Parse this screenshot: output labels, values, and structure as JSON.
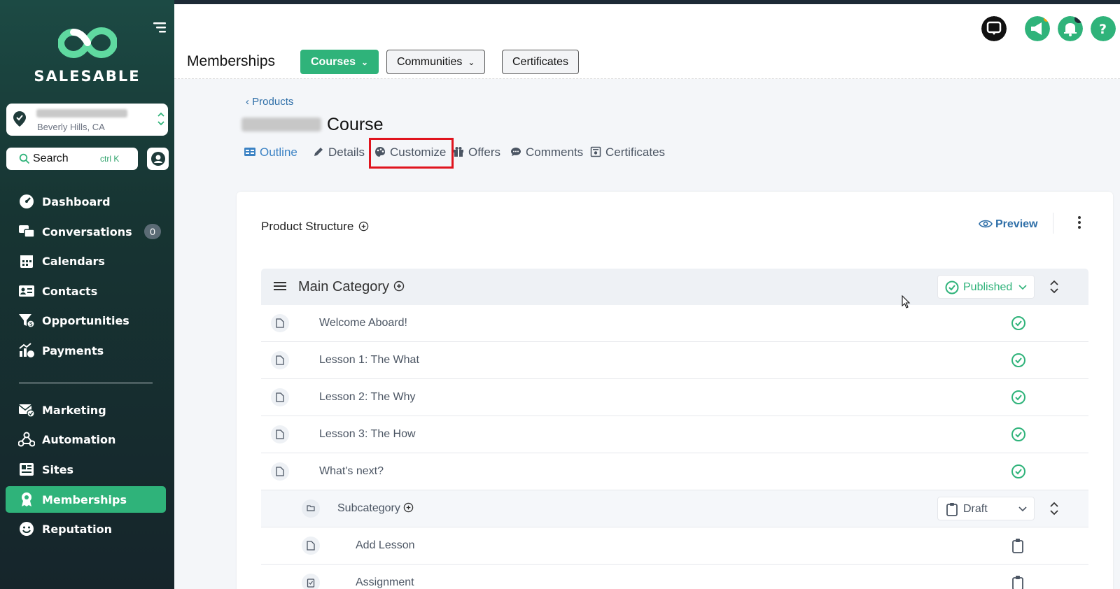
{
  "brand": {
    "name": "SALESABLE"
  },
  "location": {
    "city": "Beverly Hills, CA"
  },
  "search": {
    "label": "Search",
    "shortcut": "ctrl K"
  },
  "nav": {
    "items": [
      {
        "label": "Dashboard",
        "icon": "dashboard-icon"
      },
      {
        "label": "Conversations",
        "icon": "chat-icon",
        "badge": "0"
      },
      {
        "label": "Calendars",
        "icon": "calendar-icon"
      },
      {
        "label": "Contacts",
        "icon": "contacts-icon"
      },
      {
        "label": "Opportunities",
        "icon": "filter-dollar-icon"
      },
      {
        "label": "Payments",
        "icon": "payments-icon"
      },
      {
        "label": "Marketing",
        "icon": "mail-check-icon"
      },
      {
        "label": "Automation",
        "icon": "automation-icon"
      },
      {
        "label": "Sites",
        "icon": "sites-icon"
      },
      {
        "label": "Memberships",
        "icon": "award-icon",
        "active": true
      },
      {
        "label": "Reputation",
        "icon": "smile-icon"
      }
    ]
  },
  "header": {
    "title": "Memberships",
    "pills": [
      {
        "label": "Courses",
        "caret": true,
        "style": "green"
      },
      {
        "label": "Communities",
        "caret": true,
        "style": "grey"
      },
      {
        "label": "Certificates",
        "caret": false,
        "style": "grey"
      }
    ]
  },
  "breadcrumb": "Products",
  "course": {
    "title_suffix": "Course"
  },
  "tabs": [
    {
      "label": "Outline",
      "icon": "outline-icon",
      "active": true
    },
    {
      "label": "Details",
      "icon": "pencil-icon"
    },
    {
      "label": "Customize",
      "icon": "palette-icon",
      "highlighted": true
    },
    {
      "label": "Offers",
      "icon": "gift-icon"
    },
    {
      "label": "Comments",
      "icon": "comment-icon"
    },
    {
      "label": "Certificates",
      "icon": "certificate-icon"
    }
  ],
  "structure": {
    "title": "Product Structure",
    "preview_label": "Preview",
    "category": {
      "name": "Main Category",
      "status": "Published"
    },
    "lessons": [
      {
        "title": "Welcome Aboard!",
        "state": "published"
      },
      {
        "title": "Lesson 1: The What",
        "state": "published"
      },
      {
        "title": "Lesson 2: The Why",
        "state": "published"
      },
      {
        "title": "Lesson 3: The How",
        "state": "published"
      },
      {
        "title": "What's next?",
        "state": "published"
      }
    ],
    "subcategory": {
      "name": "Subcategory",
      "status": "Draft",
      "items": [
        {
          "title": "Add Lesson",
          "state": "draft"
        },
        {
          "title": "Assignment",
          "state": "draft"
        }
      ]
    }
  },
  "colors": {
    "accent": "#2fb37a",
    "link": "#2f6fa8",
    "highlight": "#e0141e"
  }
}
